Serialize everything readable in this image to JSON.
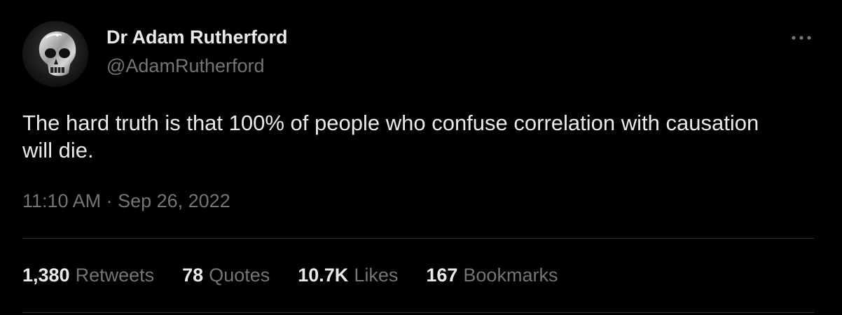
{
  "author": {
    "display_name": "Dr Adam Rutherford",
    "handle": "@AdamRutherford"
  },
  "tweet": {
    "text": "The hard truth is that 100% of people who confuse correlation with causation will die.",
    "timestamp": "11:10 AM · Sep 26, 2022"
  },
  "stats": {
    "retweets": {
      "count": "1,380",
      "label": "Retweets"
    },
    "quotes": {
      "count": "78",
      "label": "Quotes"
    },
    "likes": {
      "count": "10.7K",
      "label": "Likes"
    },
    "bookmarks": {
      "count": "167",
      "label": "Bookmarks"
    }
  },
  "icons": {
    "more": "more-horizontal-icon",
    "avatar": "skull-avatar"
  },
  "colors": {
    "background": "#000000",
    "primary_text": "#e7e9ea",
    "secondary_text": "#71767b",
    "divider": "#2f3336"
  }
}
